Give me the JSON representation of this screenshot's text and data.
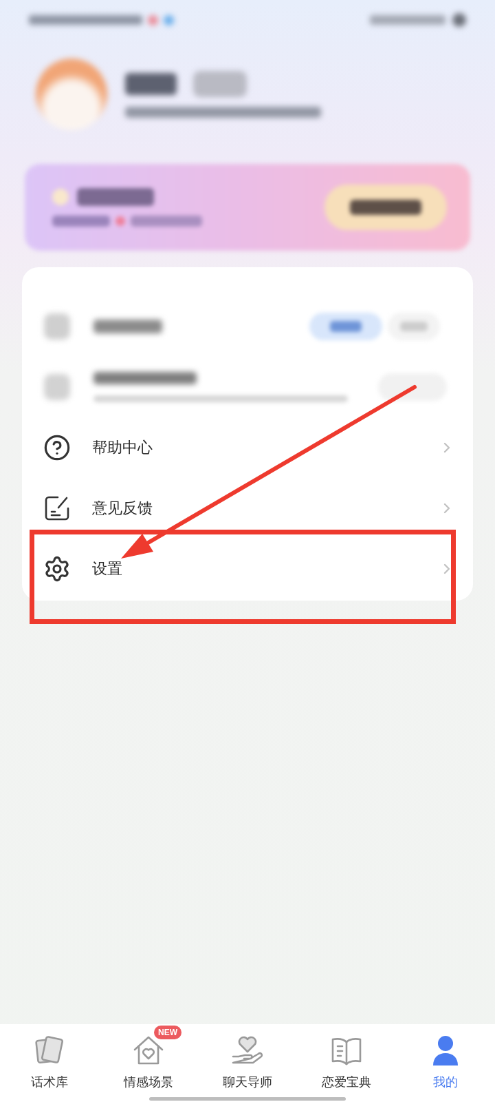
{
  "status_bar": {
    "blurred": true
  },
  "profile": {
    "blurred": true
  },
  "membership_card": {
    "blurred": true
  },
  "menu": [
    {
      "kind": "redacted_toggle"
    },
    {
      "kind": "redacted_detail"
    },
    {
      "kind": "link",
      "label": "帮助中心"
    },
    {
      "kind": "link",
      "label": "意见反馈"
    },
    {
      "kind": "link",
      "label": "设置"
    }
  ],
  "annotation": {
    "arrow": true,
    "highlight_box": true
  },
  "tab_bar": [
    {
      "label": "话术库",
      "selected": false
    },
    {
      "label": "情感场景",
      "selected": false,
      "badge": "NEW"
    },
    {
      "label": "聊天导师",
      "selected": false
    },
    {
      "label": "恋爱宝典",
      "selected": false
    },
    {
      "label": "我的",
      "selected": true
    }
  ]
}
